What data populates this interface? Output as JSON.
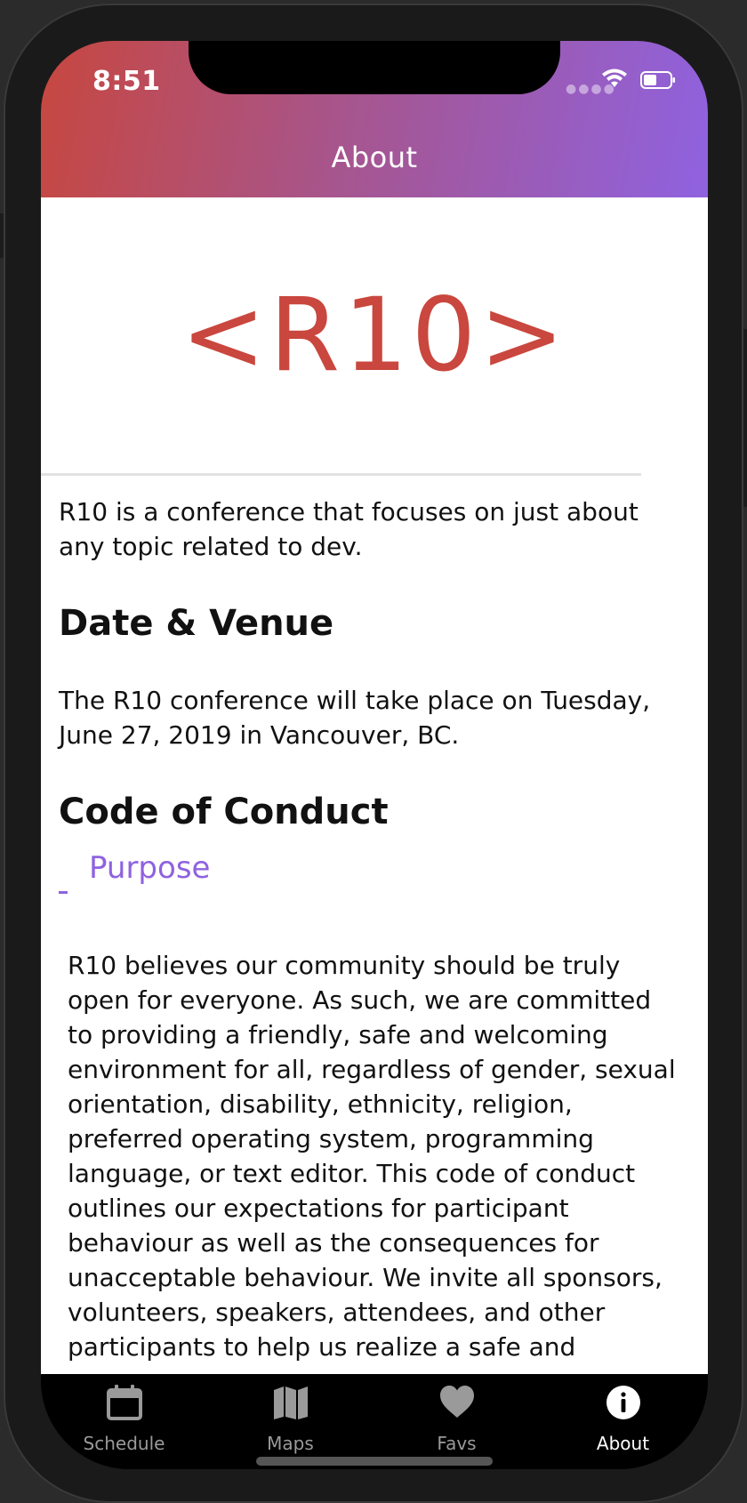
{
  "status_bar": {
    "time": "8:51"
  },
  "header": {
    "title": "About"
  },
  "about": {
    "logo": "<R10>",
    "intro": "R10 is a conference that focuses on just about any topic related to dev.",
    "date_venue_heading": "Date & Venue",
    "date_venue_text": "The R10 conference will take place on Tuesday, June 27, 2019 in Vancouver, BC.",
    "code_heading": "Code of Conduct",
    "purpose_toggle": "-",
    "purpose_title": "Purpose",
    "purpose_text": "R10 believes our community should be truly open for everyone. As such, we are committed to providing a friendly, safe and welcoming environment for all, regardless of gender, sexual orientation, disability, ethnicity, religion, preferred operating system, programming language, or text editor. This code of conduct outlines our expectations for participant behaviour as well as the consequences for unacceptable behaviour. We invite all sponsors, volunteers, speakers, attendees, and other participants to help us realize a safe and"
  },
  "tabs": [
    {
      "label": "Schedule",
      "icon": "calendar-icon"
    },
    {
      "label": "Maps",
      "icon": "map-icon"
    },
    {
      "label": "Favs",
      "icon": "heart-icon"
    },
    {
      "label": "About",
      "icon": "info-icon",
      "active": true
    }
  ],
  "colors": {
    "brand_red": "#c9473e",
    "brand_purple": "#8f62e0",
    "tab_inactive": "#9a9a9a",
    "tab_active": "#ffffff"
  }
}
